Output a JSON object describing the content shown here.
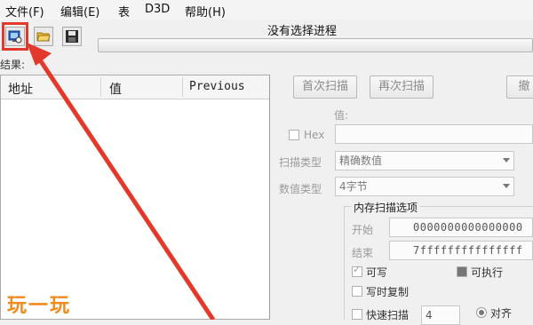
{
  "menu": [
    {
      "label": "文件(F)"
    },
    {
      "label": "编辑(E)"
    },
    {
      "label": "表"
    },
    {
      "label": "D3D"
    },
    {
      "label": "帮助(H)"
    }
  ],
  "process_title": "没有选择进程",
  "results_label": "结果:",
  "list": {
    "columns": [
      "地址",
      "值",
      "Previous"
    ]
  },
  "buttons": {
    "first_scan": "首次扫描",
    "next_scan": "再次扫描",
    "undo_scan": "撤"
  },
  "value_label": "值:",
  "hex_label": "Hex",
  "scan_type": {
    "label": "扫描类型",
    "value": "精确数值"
  },
  "value_type": {
    "label": "数值类型",
    "value": "4字节"
  },
  "memory_options": {
    "title": "内存扫描选项",
    "start_label": "开始",
    "start_value": "0000000000000000",
    "stop_label": "结束",
    "stop_value": "7fffffffffffffff",
    "writable": "可写",
    "executable": "可执行",
    "copy_on_write": "写时复制",
    "fast_scan": "快速扫描",
    "fast_scan_value": "4",
    "alignment": "对齐"
  },
  "watermark": "玩一玩",
  "colors": {
    "arrow": "#e3382c",
    "watermark_left": "#f08a1c",
    "watermark_right": "#3a8de0"
  },
  "icons": [
    "open-process-icon",
    "open-folder-icon",
    "save-disk-icon"
  ]
}
